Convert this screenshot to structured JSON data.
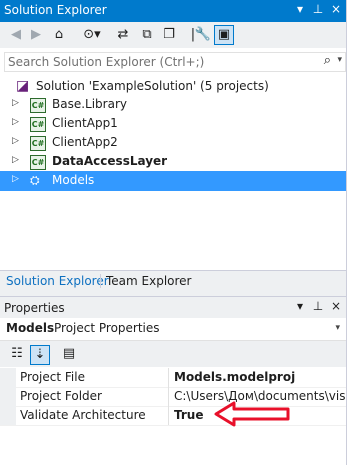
{
  "solution_explorer": {
    "title": "Solution Explorer",
    "title_buttons": [
      "▾",
      "⊥",
      "×"
    ],
    "search": {
      "placeholder": "Search Solution Explorer (Ctrl+;)"
    },
    "tree": [
      {
        "label": "Solution 'ExampleSolution' (5 projects)",
        "icon": "solution-icon",
        "bold": false,
        "selected": false
      },
      {
        "label": "Base.Library",
        "icon": "csharp-project-icon",
        "bold": false,
        "selected": false
      },
      {
        "label": "ClientApp1",
        "icon": "csharp-project-icon",
        "bold": false,
        "selected": false
      },
      {
        "label": "ClientApp2",
        "icon": "csharp-project-icon",
        "bold": false,
        "selected": false
      },
      {
        "label": "DataAccessLayer",
        "icon": "csharp-project-icon",
        "bold": true,
        "selected": false
      },
      {
        "label": "Models",
        "icon": "modeling-project-icon",
        "bold": false,
        "selected": true
      }
    ],
    "tabs": [
      "Solution Explorer",
      "Team Explorer"
    ]
  },
  "properties": {
    "title": "Properties",
    "title_buttons": [
      "▾",
      "⊥",
      "×"
    ],
    "object_name": "Models",
    "object_type": "Project Properties",
    "rows": [
      {
        "key": "Project File",
        "value": "Models.modelproj"
      },
      {
        "key": "Project Folder",
        "value": "C:\\Users\\Дом\\documents\\visual"
      },
      {
        "key": "Validate Architecture",
        "value": "True"
      }
    ]
  },
  "colors": {
    "accent": "#007acc",
    "selection": "#3399ff",
    "annotation": "#e8102a"
  }
}
